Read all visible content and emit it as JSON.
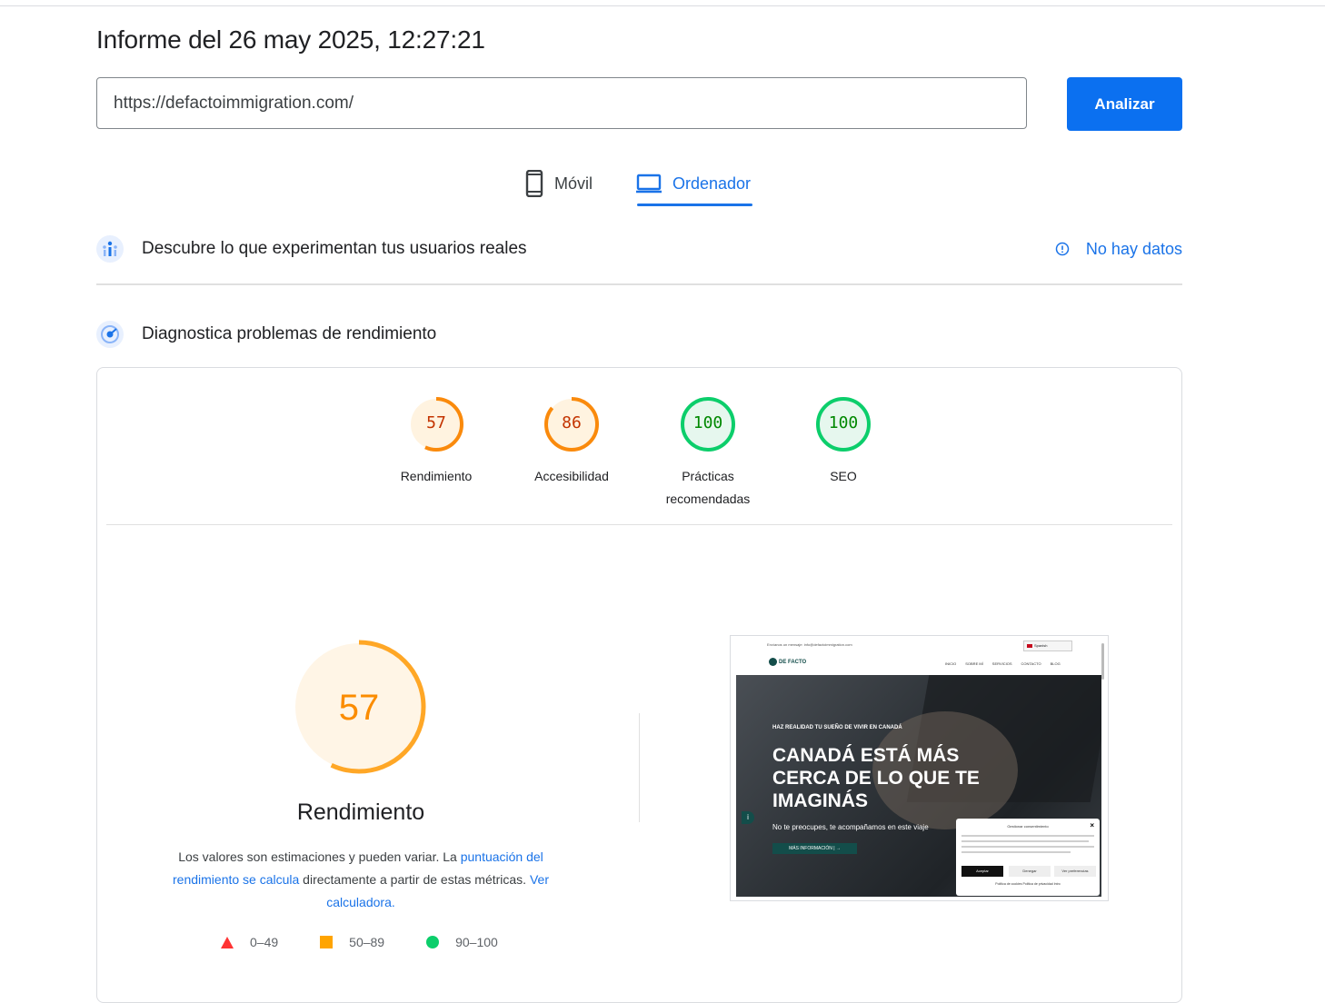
{
  "report": {
    "title": "Informe del 26 may 2025, 12:27:21"
  },
  "search": {
    "url": "https://defactoimmigration.com/",
    "button": "Analizar"
  },
  "tabs": [
    {
      "label": "Móvil",
      "icon": "smartphone-icon",
      "active": false
    },
    {
      "label": "Ordenador",
      "icon": "laptop-icon",
      "active": true
    }
  ],
  "field_data": {
    "title": "Descubre lo que experimentan tus usuarios reales",
    "status": "No hay datos",
    "icon": "people-chart-icon",
    "status_icon": "info-icon"
  },
  "lab_data": {
    "title": "Diagnostica problemas de rendimiento",
    "icon": "gauge-icon"
  },
  "scores": [
    {
      "label": "Rendimiento",
      "value": 57,
      "color": "#fa8a0c",
      "bg": "#fff3e0",
      "text_color": "#c33300"
    },
    {
      "label": "Accesibilidad",
      "value": 86,
      "color": "#fa8a0c",
      "bg": "#fff3e0",
      "text_color": "#c33300"
    },
    {
      "label": "Prácticas recomendadas",
      "value": 100,
      "color": "#0cce6b",
      "bg": "#e6f7ee",
      "text_color": "#008800"
    },
    {
      "label": "SEO",
      "value": 100,
      "color": "#0cce6b",
      "bg": "#e6f7ee",
      "text_color": "#008800"
    }
  ],
  "performance": {
    "score": 57,
    "label": "Rendimiento",
    "color": "#ffa726",
    "text_color": "#fb8c00",
    "note_prefix": "Los valores son estimaciones y pueden variar. La ",
    "note_link1": "puntuación del rendimiento se calcula",
    "note_middle": " directamente a partir de estas métricas. ",
    "note_link2": "Ver calculadora."
  },
  "legend": [
    {
      "range": "0–49",
      "shape": "triangle",
      "color": "#ff3333"
    },
    {
      "range": "50–89",
      "shape": "square",
      "color": "#ffa400"
    },
    {
      "range": "90–100",
      "shape": "circle",
      "color": "#0cce6b"
    }
  ],
  "screenshot": {
    "topbar_text": "Envíanos un mensaje: info@defactoimmigration.com",
    "language": "Spanish",
    "logo": "DE FACTO",
    "nav": [
      "INICIO",
      "SOBRE MÍ",
      "SERVICIOS",
      "CONTACTO",
      "BLOG"
    ],
    "eyebrow": "HAZ REALIDAD TU SUEÑO DE VIVIR EN CANADÁ",
    "headline": "CANADÁ ESTÁ MÁS CERCA DE LO QUE TE IMAGINÁS",
    "sub": "No te preocupes, te acompañamos en este viaje",
    "cta": "MÁS INFORMACIÓN | →",
    "consent_title": "Gestionar consentimiento",
    "consent_accept": "Aceptar",
    "consent_deny": "Denegar",
    "consent_prefs": "Ver preferencias",
    "consent_links": "Política de cookies  Política de privacidad  Intro"
  }
}
